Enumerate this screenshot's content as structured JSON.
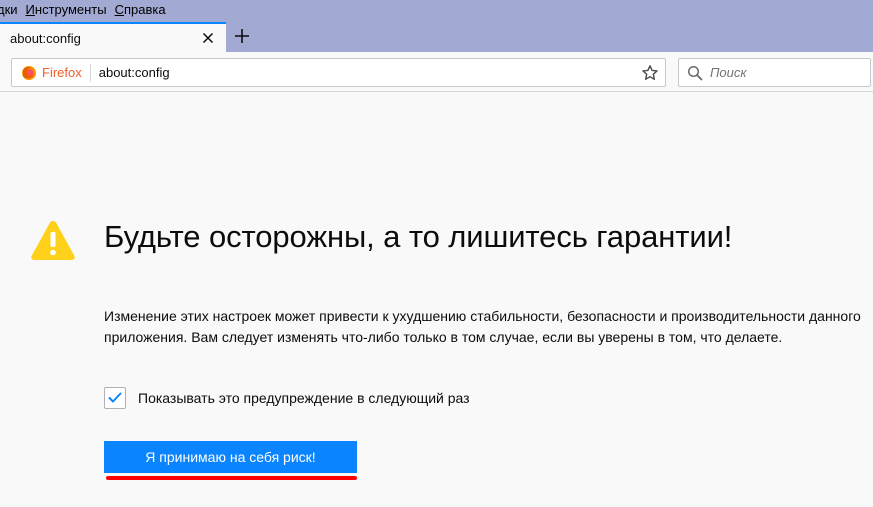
{
  "menubar": {
    "items": [
      {
        "label": "дки"
      },
      {
        "label": "Инструменты",
        "accel": "И",
        "rest": "нструменты"
      },
      {
        "label": "Справка",
        "accel": "С",
        "rest": "правка"
      }
    ]
  },
  "tab": {
    "title": "about:config"
  },
  "navbar": {
    "identity_label": "Firefox",
    "url": "about:config",
    "search_placeholder": "Поиск"
  },
  "warning": {
    "title": "Будьте осторожны, а то лишитесь гарантии!",
    "description": "Изменение этих настроек может привести к ухудшению стабильности, безопасности и производительности данного приложения. Вам следует изменять что-либо только в том случае, если вы уверены в том, что делаете.",
    "checkbox_label": "Показывать это предупреждение в следующий раз",
    "checkbox_checked": true,
    "accept_label": "Я принимаю на себя риск!"
  },
  "colors": {
    "accent": "#0a84ff",
    "menubar_bg": "#a2a9d3",
    "warning_yellow": "#ffd11a",
    "annotation_red": "#ff0000"
  },
  "icons": [
    "close-icon",
    "plus-icon",
    "firefox-icon",
    "star-icon",
    "search-icon",
    "warning-icon",
    "checkmark-icon"
  ]
}
